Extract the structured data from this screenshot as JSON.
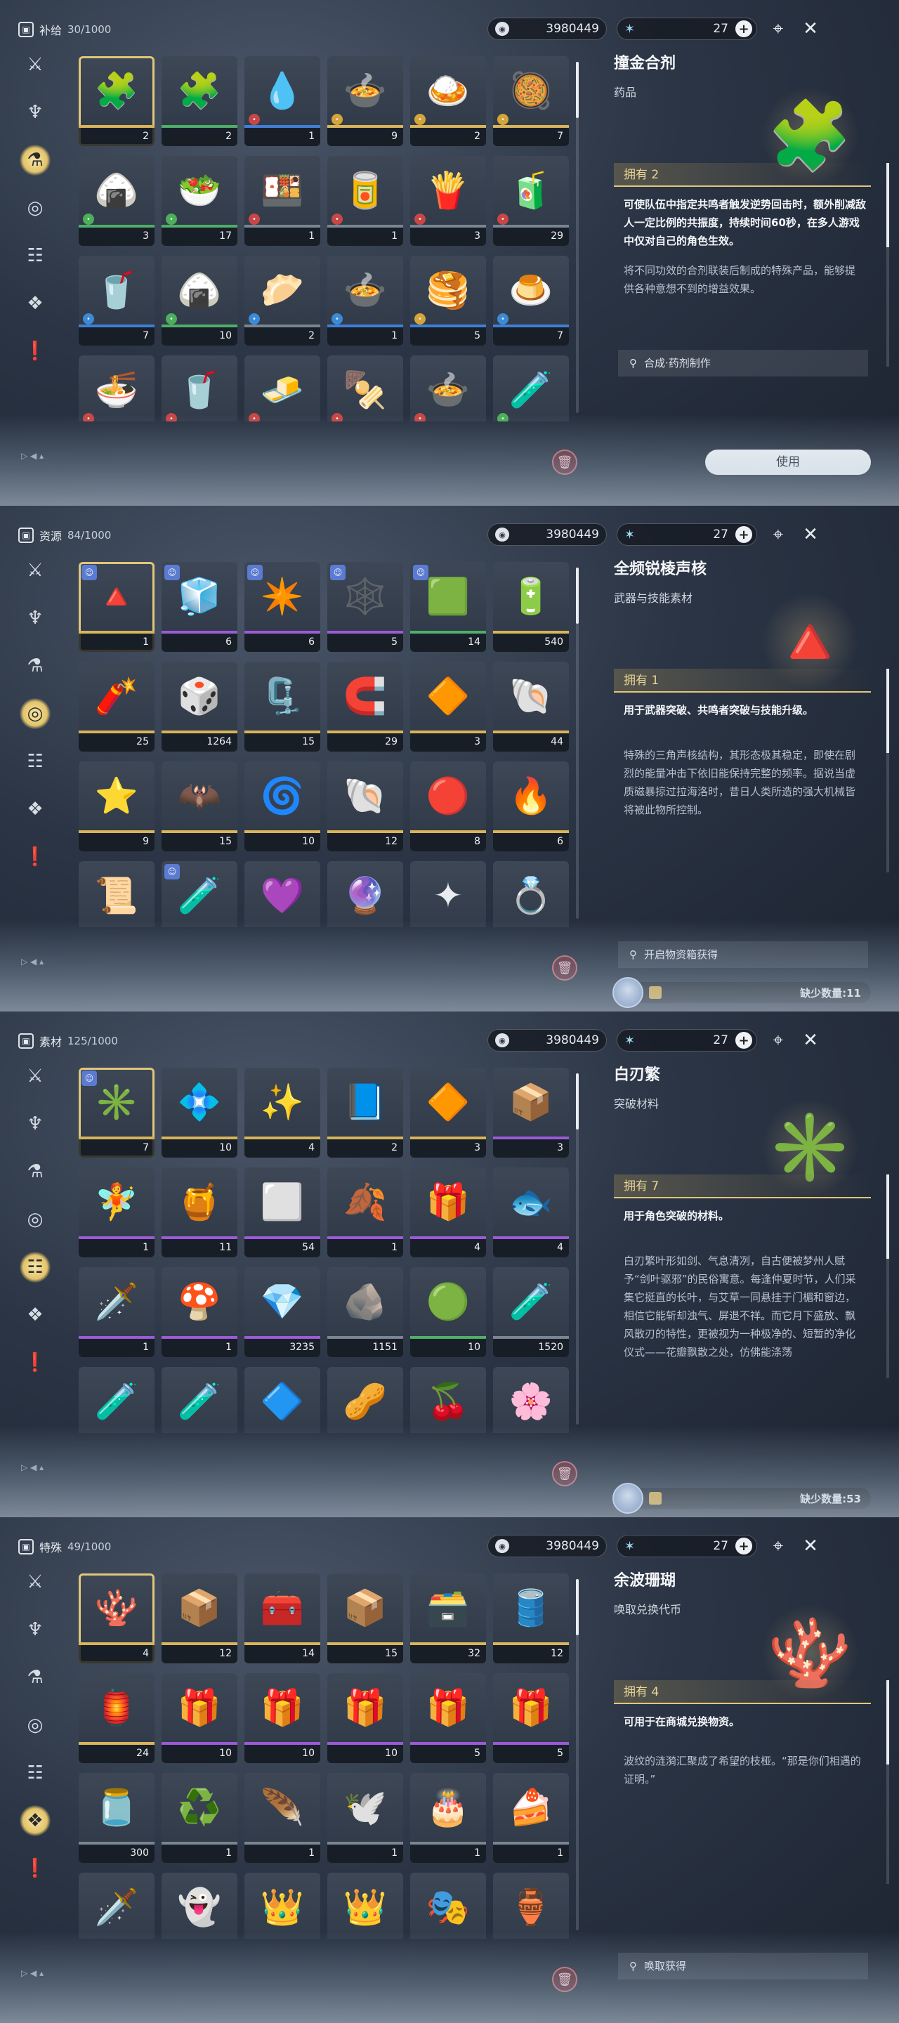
{
  "topbar": {
    "currency_value": "3980449",
    "stamina_value": "27",
    "plus": "+"
  },
  "icons": {
    "trash": "trash-icon",
    "currency": "shell-credit-icon",
    "stamina": "waveplate-icon"
  },
  "colors": {
    "gold": "#e2c779",
    "purple": "#9b5ad8",
    "blue": "#3f7fd6",
    "green": "#4fae6a"
  },
  "panels": [
    {
      "category": "补给",
      "count": "30/1000",
      "active_nav": 2,
      "items": [
        {
          "glyph": "🧩",
          "qty": "2",
          "rarity": "gold",
          "sel": true
        },
        {
          "glyph": "🧩",
          "qty": "2",
          "rarity": "green"
        },
        {
          "glyph": "💧",
          "qty": "1",
          "rarity": "blue",
          "mark": "red"
        },
        {
          "glyph": "🍲",
          "qty": "9",
          "rarity": "gold",
          "mark": "gold"
        },
        {
          "glyph": "🍛",
          "qty": "2",
          "rarity": "gold",
          "mark": "gold"
        },
        {
          "glyph": "🥘",
          "qty": "7",
          "rarity": "gold",
          "mark": "gold"
        },
        {
          "glyph": "🍙",
          "qty": "3",
          "rarity": "green",
          "mark": "green"
        },
        {
          "glyph": "🥗",
          "qty": "17",
          "rarity": "green",
          "mark": "green"
        },
        {
          "glyph": "🍱",
          "qty": "1",
          "rarity": "grey",
          "mark": "red"
        },
        {
          "glyph": "🥫",
          "qty": "1",
          "rarity": "grey",
          "mark": "red"
        },
        {
          "glyph": "🍟",
          "qty": "3",
          "rarity": "grey",
          "mark": "red"
        },
        {
          "glyph": "🧃",
          "qty": "29",
          "rarity": "grey",
          "mark": "red"
        },
        {
          "glyph": "🥤",
          "qty": "7",
          "rarity": "blue",
          "mark": "blue"
        },
        {
          "glyph": "🍙",
          "qty": "10",
          "rarity": "green",
          "mark": "green"
        },
        {
          "glyph": "🥟",
          "qty": "2",
          "rarity": "grey",
          "mark": "blue"
        },
        {
          "glyph": "🍲",
          "qty": "1",
          "rarity": "blue",
          "mark": "blue"
        },
        {
          "glyph": "🥞",
          "qty": "5",
          "rarity": "blue",
          "mark": "gold"
        },
        {
          "glyph": "🍮",
          "qty": "7",
          "rarity": "blue",
          "mark": "blue"
        },
        {
          "glyph": "🍜",
          "qty": "",
          "rarity": "grey",
          "mark": "red"
        },
        {
          "glyph": "🥤",
          "qty": "",
          "rarity": "grey",
          "mark": "red"
        },
        {
          "glyph": "🧈",
          "qty": "",
          "rarity": "grey",
          "mark": "red"
        },
        {
          "glyph": "🍢",
          "qty": "",
          "rarity": "grey",
          "mark": "red"
        },
        {
          "glyph": "🍲",
          "qty": "",
          "rarity": "grey",
          "mark": "red"
        },
        {
          "glyph": "🧪",
          "qty": "",
          "rarity": "grey",
          "mark": "green"
        }
      ],
      "detail": {
        "name": "撞金合剂",
        "type": "药品",
        "glyph": "🧩",
        "owned": "拥有 2",
        "effect": "可使队伍中指定共鸣者触发逆势回击时，额外削减敌人一定比例的共振度，持续时间60秒，在多人游戏中仅对自己的角色生效。",
        "desc": "将不同功效的合剂联装后制成的特殊产品，能够提供各种意想不到的增益效果。",
        "source": "合成·药剂制作",
        "use": "使用",
        "lack": ""
      }
    },
    {
      "category": "资源",
      "count": "84/1000",
      "active_nav": 3,
      "items": [
        {
          "glyph": "🔺",
          "qty": "1",
          "rarity": "gold",
          "sel": true,
          "badge": true
        },
        {
          "glyph": "🧊",
          "qty": "6",
          "rarity": "purple",
          "badge": true
        },
        {
          "glyph": "✴️",
          "qty": "6",
          "rarity": "purple",
          "badge": true
        },
        {
          "glyph": "🕸️",
          "qty": "5",
          "rarity": "purple",
          "badge": true
        },
        {
          "glyph": "🟩",
          "qty": "14",
          "rarity": "green",
          "badge": true
        },
        {
          "glyph": "🔋",
          "qty": "540",
          "rarity": "gold"
        },
        {
          "glyph": "🧨",
          "qty": "25",
          "rarity": "gold"
        },
        {
          "glyph": "🎲",
          "qty": "1264",
          "rarity": "gold"
        },
        {
          "glyph": "🗜️",
          "qty": "15",
          "rarity": "gold"
        },
        {
          "glyph": "🧲",
          "qty": "29",
          "rarity": "gold"
        },
        {
          "glyph": "🔶",
          "qty": "3",
          "rarity": "gold"
        },
        {
          "glyph": "🐚",
          "qty": "44",
          "rarity": "gold"
        },
        {
          "glyph": "⭐",
          "qty": "9",
          "rarity": "gold"
        },
        {
          "glyph": "🦇",
          "qty": "15",
          "rarity": "gold"
        },
        {
          "glyph": "🌀",
          "qty": "10",
          "rarity": "gold"
        },
        {
          "glyph": "🐚",
          "qty": "12",
          "rarity": "gold"
        },
        {
          "glyph": "🔴",
          "qty": "8",
          "rarity": "gold"
        },
        {
          "glyph": "🔥",
          "qty": "6",
          "rarity": "gold"
        },
        {
          "glyph": "📜",
          "qty": "",
          "rarity": "grey"
        },
        {
          "glyph": "🧪",
          "qty": "",
          "rarity": "purple",
          "badge": true
        },
        {
          "glyph": "💜",
          "qty": "",
          "rarity": "purple"
        },
        {
          "glyph": "🔮",
          "qty": "",
          "rarity": "purple"
        },
        {
          "glyph": "✦",
          "qty": "",
          "rarity": "gold"
        },
        {
          "glyph": "💍",
          "qty": "",
          "rarity": "gold"
        }
      ],
      "detail": {
        "name": "全频锐棱声核",
        "type": "武器与技能素材",
        "glyph": "🔺",
        "owned": "拥有 1",
        "effect": "用于武器突破、共鸣者突破与技能升级。",
        "desc": "特殊的三角声核结构，其形态极其稳定，即使在剧烈的能量冲击下依旧能保持完整的频率。据说当虚质磁暴掠过拉海洛时，昔日人类所造的强大机械皆将被此物所控制。",
        "source": "开启物资箱获得",
        "use": "",
        "lack": "缺少数量:11"
      }
    },
    {
      "category": "素材",
      "count": "125/1000",
      "active_nav": 4,
      "items": [
        {
          "glyph": "✳️",
          "qty": "7",
          "rarity": "gold",
          "sel": true,
          "badge": true
        },
        {
          "glyph": "💠",
          "qty": "10",
          "rarity": "gold"
        },
        {
          "glyph": "✨",
          "qty": "4",
          "rarity": "gold"
        },
        {
          "glyph": "📘",
          "qty": "2",
          "rarity": "gold"
        },
        {
          "glyph": "🔶",
          "qty": "3",
          "rarity": "gold"
        },
        {
          "glyph": "📦",
          "qty": "3",
          "rarity": "purple"
        },
        {
          "glyph": "🧚",
          "qty": "1",
          "rarity": "purple"
        },
        {
          "glyph": "🍯",
          "qty": "11",
          "rarity": "purple"
        },
        {
          "glyph": "⬜",
          "qty": "54",
          "rarity": "purple"
        },
        {
          "glyph": "🍂",
          "qty": "1",
          "rarity": "purple"
        },
        {
          "glyph": "🎁",
          "qty": "4",
          "rarity": "purple"
        },
        {
          "glyph": "🐟",
          "qty": "4",
          "rarity": "purple"
        },
        {
          "glyph": "🗡️",
          "qty": "1",
          "rarity": "purple"
        },
        {
          "glyph": "🍄",
          "qty": "1",
          "rarity": "purple"
        },
        {
          "glyph": "💎",
          "qty": "3235",
          "rarity": "purple"
        },
        {
          "glyph": "🪨",
          "qty": "1151",
          "rarity": "grey"
        },
        {
          "glyph": "🟢",
          "qty": "10",
          "rarity": "green"
        },
        {
          "glyph": "🧪",
          "qty": "1520",
          "rarity": "grey"
        },
        {
          "glyph": "🧪",
          "qty": "",
          "rarity": "grey"
        },
        {
          "glyph": "🧪",
          "qty": "",
          "rarity": "grey"
        },
        {
          "glyph": "🔷",
          "qty": "",
          "rarity": "grey"
        },
        {
          "glyph": "🥜",
          "qty": "",
          "rarity": "grey"
        },
        {
          "glyph": "🍒",
          "qty": "",
          "rarity": "grey"
        },
        {
          "glyph": "🌸",
          "qty": "",
          "rarity": "grey"
        }
      ],
      "detail": {
        "name": "白刃繁",
        "type": "突破材料",
        "glyph": "✳️",
        "owned": "拥有 7",
        "effect": "用于角色突破的材料。",
        "desc": "白刃繁叶形如剑、气息清冽，自古便被梦州人赋予“剑叶驱邪”的民俗寓意。每逢仲夏时节，人们采集它挺直的长叶，与艾草一同悬挂于门楣和窗边，相信它能斩却浊气、屏退不祥。而它月下盛放、飘风散刃的特性，更被视为一种极净的、短暂的净化仪式——花瓣飘散之处，仿佛能涤荡",
        "source": "",
        "use": "",
        "lack": "缺少数量:53"
      }
    },
    {
      "category": "特殊",
      "count": "49/1000",
      "active_nav": 5,
      "items": [
        {
          "glyph": "🪸",
          "qty": "4",
          "rarity": "gold",
          "sel": true
        },
        {
          "glyph": "📦",
          "qty": "12",
          "rarity": "gold"
        },
        {
          "glyph": "🧰",
          "qty": "14",
          "rarity": "gold"
        },
        {
          "glyph": "📦",
          "qty": "15",
          "rarity": "gold"
        },
        {
          "glyph": "🗃️",
          "qty": "32",
          "rarity": "gold"
        },
        {
          "glyph": "🛢️",
          "qty": "12",
          "rarity": "gold"
        },
        {
          "glyph": "🏮",
          "qty": "24",
          "rarity": "gold"
        },
        {
          "glyph": "🎁",
          "qty": "10",
          "rarity": "purple"
        },
        {
          "glyph": "🎁",
          "qty": "10",
          "rarity": "purple"
        },
        {
          "glyph": "🎁",
          "qty": "10",
          "rarity": "purple"
        },
        {
          "glyph": "🎁",
          "qty": "5",
          "rarity": "purple"
        },
        {
          "glyph": "🎁",
          "qty": "5",
          "rarity": "purple"
        },
        {
          "glyph": "🫙",
          "qty": "300",
          "rarity": "grey"
        },
        {
          "glyph": "♻️",
          "qty": "1",
          "rarity": "grey"
        },
        {
          "glyph": "🪶",
          "qty": "1",
          "rarity": "grey"
        },
        {
          "glyph": "🕊️",
          "qty": "1",
          "rarity": "grey"
        },
        {
          "glyph": "🎂",
          "qty": "1",
          "rarity": "grey"
        },
        {
          "glyph": "🍰",
          "qty": "1",
          "rarity": "grey"
        },
        {
          "glyph": "🗡️",
          "qty": "",
          "rarity": "grey"
        },
        {
          "glyph": "👻",
          "qty": "",
          "rarity": "grey"
        },
        {
          "glyph": "👑",
          "qty": "",
          "rarity": "grey"
        },
        {
          "glyph": "👑",
          "qty": "",
          "rarity": "grey"
        },
        {
          "glyph": "🎭",
          "qty": "",
          "rarity": "grey"
        },
        {
          "glyph": "🏺",
          "qty": "",
          "rarity": "grey"
        }
      ],
      "detail": {
        "name": "余波珊瑚",
        "type": "唤取兑换代币",
        "glyph": "🪸",
        "owned": "拥有 4",
        "effect": "可用于在商城兑换物资。",
        "desc": "波纹的涟漪汇聚成了希望的枝桠。“那是你们相遇的证明。”",
        "source": "唤取获得",
        "use": "",
        "lack": ""
      }
    }
  ]
}
